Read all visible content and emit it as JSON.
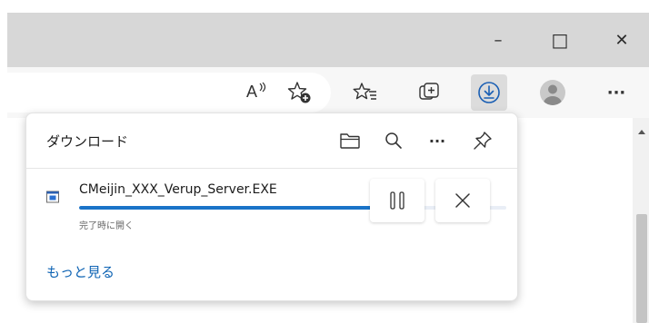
{
  "window": {
    "minimize_glyph": "–",
    "maximize_glyph": "□",
    "close_glyph": "✕"
  },
  "toolbar": {
    "read_aloud_label": "A",
    "icons": [
      "read-aloud-icon",
      "add-favorite-icon",
      "favorites-icon",
      "collections-icon",
      "download-icon",
      "profile-icon",
      "more-icon"
    ],
    "more_glyph": "···"
  },
  "downloads_panel": {
    "title": "ダウンロード",
    "header_icons": [
      "open-folder-icon",
      "search-icon",
      "more-options-icon",
      "pin-icon"
    ],
    "more_glyph": "···",
    "item": {
      "file_name": "CMeijin_XXX_Verup_Server.EXE",
      "status": "完了時に開く",
      "progress": 0.74,
      "pause_icon": "pause-icon",
      "cancel_icon": "cancel-icon"
    },
    "see_more_label": "もっと見る"
  },
  "colors": {
    "accent": "#1a73c8",
    "link": "#0f64b4",
    "titlebar": "#d7d7d7"
  }
}
